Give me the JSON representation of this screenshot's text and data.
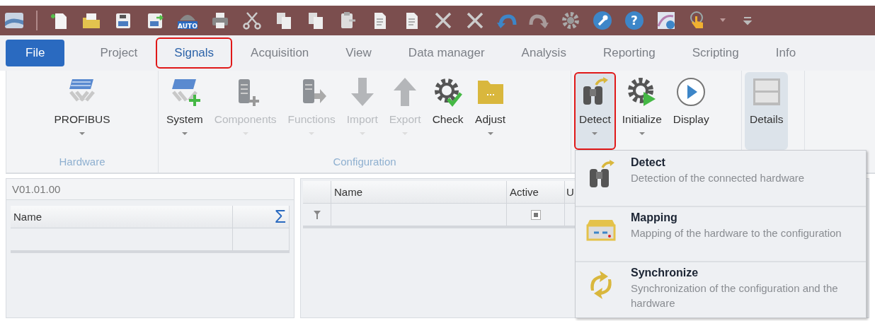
{
  "quick_access": {
    "auto_label": "AUTO",
    "help_label": "?"
  },
  "tabs": [
    {
      "label": "File",
      "kind": "file",
      "selected": false,
      "marked": false
    },
    {
      "label": "Project",
      "kind": "tab",
      "selected": false,
      "marked": false
    },
    {
      "label": "Signals",
      "kind": "tab",
      "selected": true,
      "marked": true
    },
    {
      "label": "Acquisition",
      "kind": "tab",
      "selected": false,
      "marked": false
    },
    {
      "label": "View",
      "kind": "tab",
      "selected": false,
      "marked": false
    },
    {
      "label": "Data manager",
      "kind": "tab",
      "selected": false,
      "marked": false
    },
    {
      "label": "Analysis",
      "kind": "tab",
      "selected": false,
      "marked": false
    },
    {
      "label": "Reporting",
      "kind": "tab",
      "selected": false,
      "marked": false
    },
    {
      "label": "Scripting",
      "kind": "tab",
      "selected": false,
      "marked": false
    },
    {
      "label": "Info",
      "kind": "tab",
      "selected": false,
      "marked": false
    }
  ],
  "ribbon_groups": [
    {
      "label": "Hardware",
      "buttons": [
        {
          "label": "PROFIBUS",
          "has_menu": true,
          "disabled": false,
          "pressed": false,
          "marked": false
        }
      ]
    },
    {
      "label": "Configuration",
      "buttons": [
        {
          "label": "System",
          "has_menu": true,
          "disabled": false,
          "pressed": false,
          "marked": false
        },
        {
          "label": "Components",
          "has_menu": true,
          "disabled": true,
          "pressed": false,
          "marked": false
        },
        {
          "label": "Functions",
          "has_menu": true,
          "disabled": true,
          "pressed": false,
          "marked": false
        },
        {
          "label": "Import",
          "has_menu": true,
          "disabled": true,
          "pressed": false,
          "marked": false
        },
        {
          "label": "Export",
          "has_menu": true,
          "disabled": true,
          "pressed": false,
          "marked": false
        },
        {
          "label": "Check",
          "has_menu": false,
          "disabled": false,
          "pressed": false,
          "marked": false
        },
        {
          "label": "Adjust",
          "has_menu": true,
          "disabled": false,
          "pressed": false,
          "marked": false
        }
      ]
    },
    {
      "buttons": [
        {
          "label": "Detect",
          "has_menu": true,
          "disabled": false,
          "pressed": true,
          "marked": true
        },
        {
          "label": "Initialize",
          "has_menu": true,
          "disabled": false,
          "pressed": false,
          "marked": false
        },
        {
          "label": "Display",
          "has_menu": false,
          "disabled": false,
          "pressed": false,
          "marked": false
        }
      ]
    },
    {
      "buttons": [
        {
          "label": "Details",
          "has_menu": false,
          "disabled": false,
          "pressed": true,
          "marked": false
        }
      ]
    }
  ],
  "left_panel": {
    "title": "V01.01.00",
    "columns": [
      "Name",
      "Σ"
    ]
  },
  "right_panel": {
    "columns": [
      "Name",
      "Active",
      "U"
    ],
    "rows": [
      {
        "indeterminate": true
      }
    ]
  },
  "dropdown_menu": {
    "items": [
      {
        "title": "Detect",
        "description": "Detection of the connected hardware"
      },
      {
        "title": "Mapping",
        "description": "Mapping of the hardware to the configuration"
      },
      {
        "title": "Synchronize",
        "description": "Synchronization of the configuration and the hardware"
      }
    ]
  }
}
